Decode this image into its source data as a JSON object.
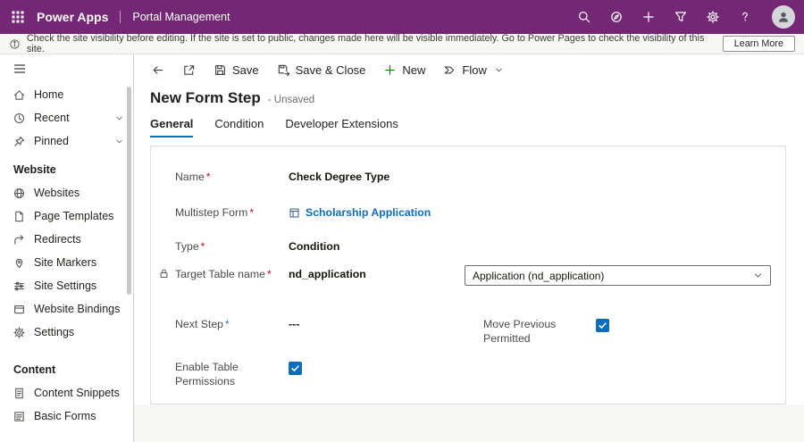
{
  "colors": {
    "topbar": "#742774",
    "accent": "#0f6cbd",
    "link": "#0f6cbd",
    "checkbox": "#0f6cbd",
    "required_marker": "#b10e1c"
  },
  "topbar": {
    "app_name": "Power Apps",
    "section_title": "Portal Management",
    "icons": [
      "app-launcher",
      "search",
      "compass",
      "quick-create-plus",
      "filter",
      "settings-gear",
      "help",
      "avatar"
    ]
  },
  "banner": {
    "message": "Check the site visibility before editing. If the site is set to public, changes made here will be visible immediately. Go to Power Pages to check the visibility of this site.",
    "action_label": "Learn More"
  },
  "sidebar": {
    "items_top": [
      {
        "label": "Home",
        "icon": "home"
      },
      {
        "label": "Recent",
        "icon": "clock",
        "expandable": true
      },
      {
        "label": "Pinned",
        "icon": "pin",
        "expandable": true
      }
    ],
    "sections": [
      {
        "title": "Website",
        "items": [
          {
            "label": "Websites",
            "icon": "globe"
          },
          {
            "label": "Page Templates",
            "icon": "page"
          },
          {
            "label": "Redirects",
            "icon": "redirect-arrow"
          },
          {
            "label": "Site Markers",
            "icon": "map-marker"
          },
          {
            "label": "Site Settings",
            "icon": "sliders"
          },
          {
            "label": "Website Bindings",
            "icon": "browser-window"
          },
          {
            "label": "Settings",
            "icon": "gear"
          }
        ]
      },
      {
        "title": "Content",
        "items": [
          {
            "label": "Content Snippets",
            "icon": "document-lines"
          },
          {
            "label": "Basic Forms",
            "icon": "form"
          }
        ]
      }
    ]
  },
  "command_bar": {
    "save_label": "Save",
    "save_close_label": "Save & Close",
    "new_label": "New",
    "flow_label": "Flow"
  },
  "page": {
    "title": "New Form Step",
    "status": "- Unsaved",
    "tabs": [
      {
        "label": "General",
        "active": true
      },
      {
        "label": "Condition",
        "active": false
      },
      {
        "label": "Developer Extensions",
        "active": false
      }
    ]
  },
  "form": {
    "name": {
      "label": "Name",
      "marker": "*",
      "value": "Check Degree Type"
    },
    "multistep_form": {
      "label": "Multistep Form",
      "marker": "*",
      "value": "Scholarship Application"
    },
    "type": {
      "label": "Type",
      "marker": "*",
      "value": "Condition"
    },
    "target_table": {
      "label": "Target Table name",
      "marker": "*",
      "value": "nd_application",
      "dropdown_value": "Application (nd_application)"
    },
    "next_step": {
      "label": "Next Step",
      "marker": "*",
      "value": "---"
    },
    "move_previous": {
      "label": "Move Previous Permitted",
      "checked": true
    },
    "enable_table_permissions": {
      "label": "Enable Table Permissions",
      "checked": true
    }
  }
}
